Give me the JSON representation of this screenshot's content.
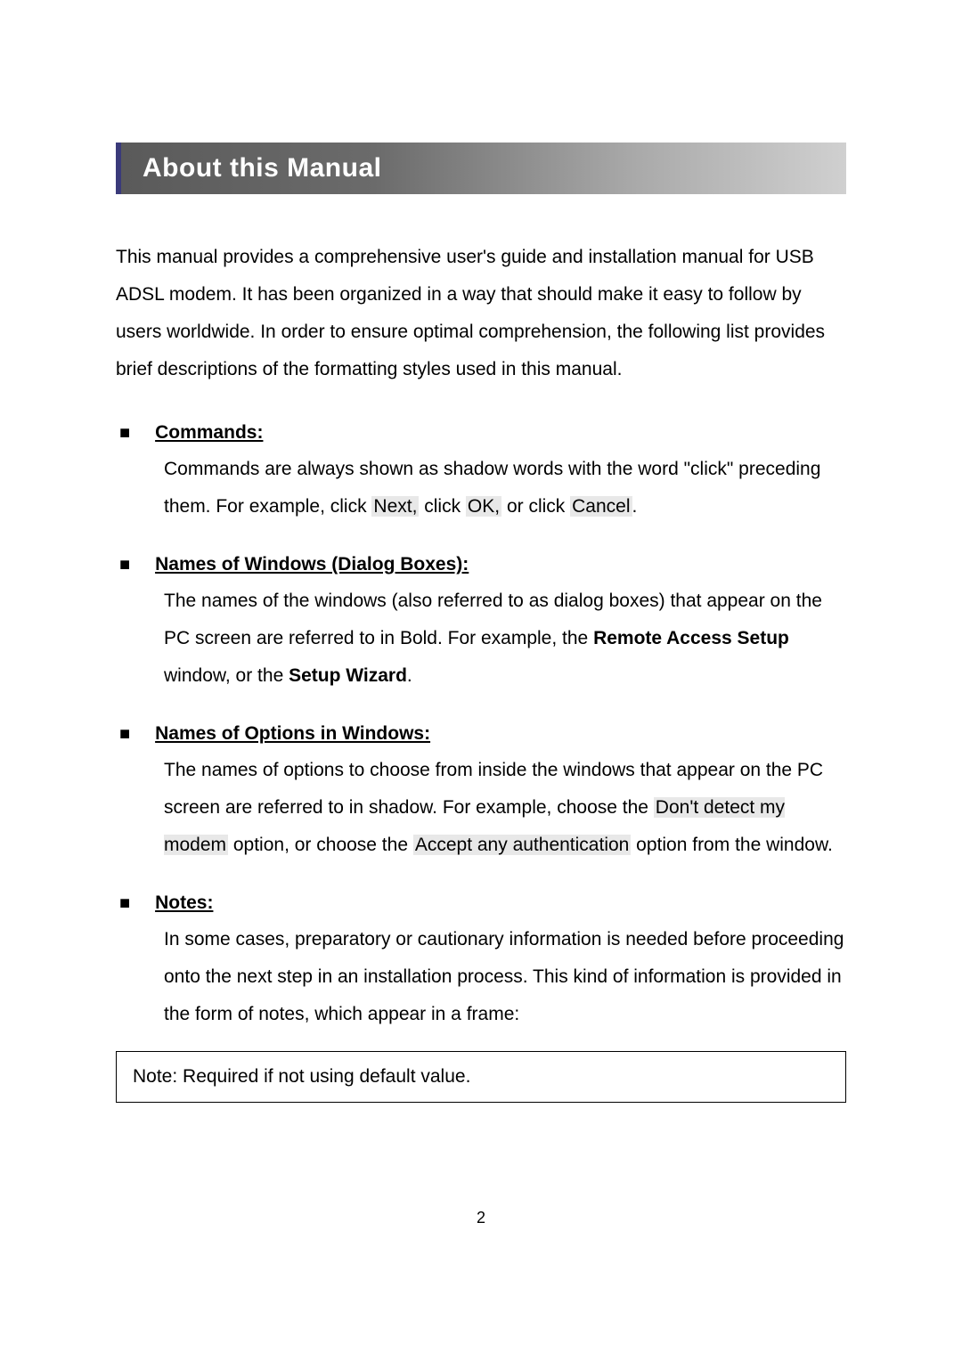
{
  "header": {
    "title": "About this Manual"
  },
  "intro": "This manual provides a comprehensive user's guide and installation manual for USB ADSL modem. It has been organized in a way that should make it easy to follow by users worldwide. In order to ensure optimal comprehension, the following list provides brief descriptions of the formatting styles used in this manual.",
  "bullets": {
    "commands": {
      "title": "Commands:",
      "text_before": "Commands are always shown as shadow words with the word \"click\" preceding them. For example, click ",
      "shadow1": "Next,",
      "mid1": " click ",
      "shadow2": "OK,",
      "mid2": " or click ",
      "shadow3": "Cancel",
      "after": "."
    },
    "windows": {
      "title": "Names of Windows (Dialog Boxes):",
      "text_before": "The names of the windows (also referred to as dialog boxes) that appear on the PC screen are referred to in Bold.  For example, the ",
      "bold1": "Remote Access Setup",
      "mid1": " window, or the ",
      "bold2": "Setup Wizard",
      "after": "."
    },
    "options": {
      "title": "Names of Options in Windows:",
      "text_before": "The names of options to choose from inside the windows that appear on the PC screen are referred to in shadow.  For example, choose the ",
      "shadow1": "Don't detect my modem",
      "mid1": " option, or choose the ",
      "shadow2": "Accept any authentication",
      "after": " option from the window."
    },
    "notes": {
      "title": "Notes:",
      "text": "In some cases, preparatory or cautionary information is needed before proceeding onto the next step in an installation process.  This kind of information is provided in the form of notes, which appear in a frame:"
    }
  },
  "note_box": "Note: Required if not using default value.",
  "page_number": "2"
}
